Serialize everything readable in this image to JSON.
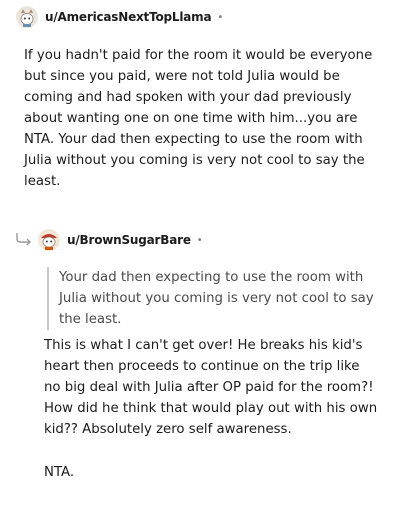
{
  "comments": [
    {
      "username": "u/AmericasNextTopLlama",
      "separator": "•",
      "avatar_icon": "snoo-avatar-icon",
      "body": "If you hadn't paid for the room it would be everyone but since you paid, were not told Julia would be coming and had spoken with your dad previously about wanting one on one time with him...you are NTA. Your dad then expecting to use the room with Julia without you coming is very not cool to say the least."
    },
    {
      "username": "u/BrownSugarBare",
      "separator": "•",
      "avatar_icon": "snoo-avatar-icon",
      "reply_icon": "reply-arrow-icon",
      "quote": "Your dad then expecting to use the room with Julia without you coming is very not cool to say the least.",
      "paragraphs": [
        "This is what I can't get over! He breaks his kid's heart then proceeds to continue on the trip like no big deal with Julia after OP paid for the room?! How did he think that would play out with his own kid?? Absolutely zero self awareness.",
        "NTA."
      ]
    }
  ],
  "colors": {
    "text": "#1c1c1c",
    "muted": "#7c7c7c",
    "quote_bar": "#c7c7c7"
  }
}
